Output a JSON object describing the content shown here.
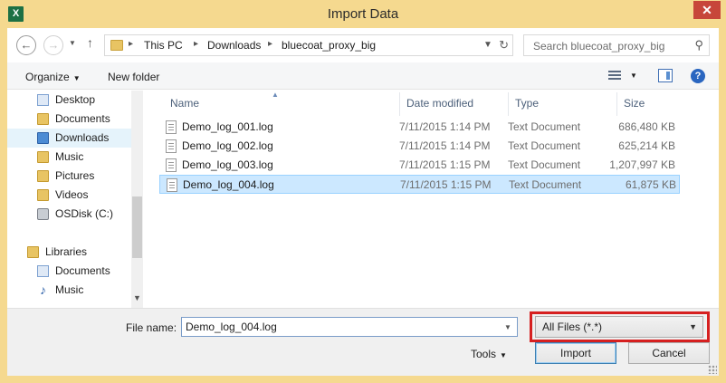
{
  "window": {
    "title": "Import Data",
    "app_icon": "X",
    "close": "✕"
  },
  "address": {
    "crumbs": [
      "This PC",
      "Downloads",
      "bluecoat_proxy_big"
    ],
    "search_placeholder": "Search bluecoat_proxy_big"
  },
  "toolbar": {
    "organize": "Organize",
    "new_folder": "New folder"
  },
  "navpane": {
    "items": [
      {
        "label": "Desktop",
        "icon": "desktop-folder-icon"
      },
      {
        "label": "Documents",
        "icon": "documents-folder-icon"
      },
      {
        "label": "Downloads",
        "icon": "downloads-folder-icon"
      },
      {
        "label": "Music",
        "icon": "music-folder-icon"
      },
      {
        "label": "Pictures",
        "icon": "pictures-folder-icon"
      },
      {
        "label": "Videos",
        "icon": "videos-folder-icon"
      },
      {
        "label": "OSDisk (C:)",
        "icon": "disk-icon"
      },
      {
        "label": "Libraries",
        "icon": "libraries-icon"
      },
      {
        "label": "Documents",
        "icon": "documents-library-icon"
      },
      {
        "label": "Music",
        "icon": "music-note-icon"
      }
    ],
    "selected": "Downloads"
  },
  "filelist": {
    "columns": [
      "Name",
      "Date modified",
      "Type",
      "Size"
    ],
    "rows": [
      {
        "name": "Demo_log_001.log",
        "date": "7/11/2015 1:14 PM",
        "type": "Text Document",
        "size": "686,480 KB"
      },
      {
        "name": "Demo_log_002.log",
        "date": "7/11/2015 1:14 PM",
        "type": "Text Document",
        "size": "625,214 KB"
      },
      {
        "name": "Demo_log_003.log",
        "date": "7/11/2015 1:15 PM",
        "type": "Text Document",
        "size": "1,207,997 KB"
      },
      {
        "name": "Demo_log_004.log",
        "date": "7/11/2015 1:15 PM",
        "type": "Text Document",
        "size": "61,875 KB"
      }
    ],
    "selected_row": 3
  },
  "bottom": {
    "file_name_label": "File name:",
    "file_name_value": "Demo_log_004.log",
    "file_type": "All Files (*.*)",
    "tools": "Tools",
    "import": "Import",
    "cancel": "Cancel"
  },
  "colors": {
    "title_bar": "#f5d98f",
    "close_button": "#c7463a",
    "highlight_box": "#d62020",
    "selection": "#cce8ff"
  }
}
